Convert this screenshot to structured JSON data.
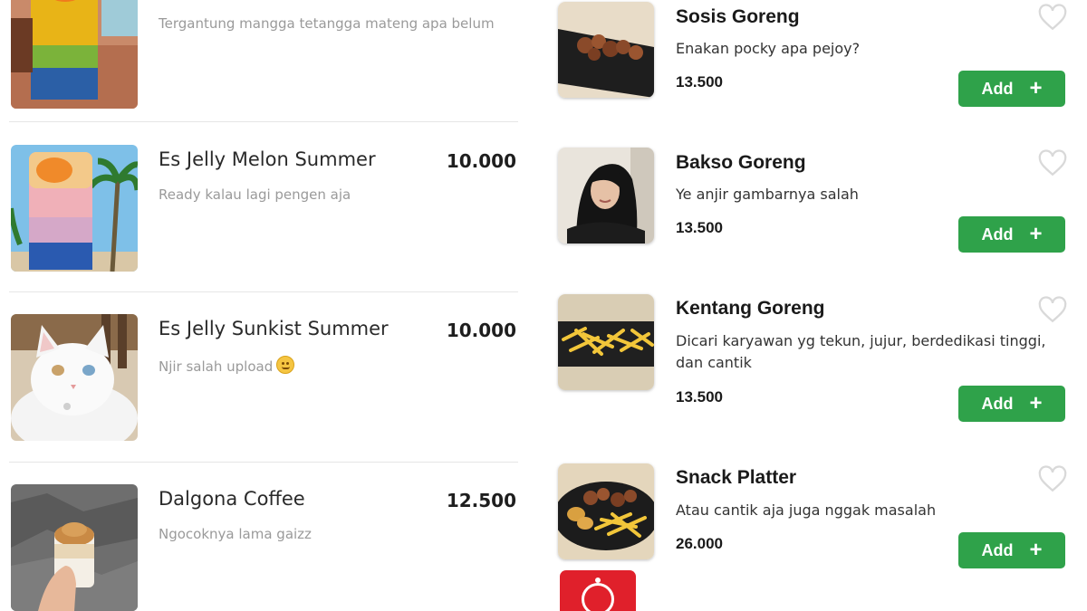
{
  "left_menu": {
    "items": [
      {
        "name": "",
        "price": "",
        "description": "Tergantung mangga tetangga mateng apa belum",
        "image": "layered-fruit-drink"
      },
      {
        "name": "Es Jelly Melon Summer",
        "price": "10.000",
        "description": "Ready kalau lagi pengen aja",
        "image": "melon-jelly-drink"
      },
      {
        "name": "Es Jelly Sunkist Summer",
        "price": "10.000",
        "description": "Njir salah upload",
        "image": "white-cat-photo",
        "emoji": "grimacing-face"
      },
      {
        "name": "Dalgona Coffee",
        "price": "12.500",
        "description": "Ngocoknya lama gaizz",
        "image": "dalgona-coffee-cup"
      }
    ]
  },
  "right_menu": {
    "add_label": "Add",
    "items": [
      {
        "name": "Sosis Goreng",
        "description": "Enakan pocky apa pejoy?",
        "price": "13.500",
        "image": "fried-sausage-plate"
      },
      {
        "name": "Bakso Goreng",
        "description": "Ye anjir gambarnya salah",
        "price": "13.500",
        "image": "woman-selfie-photo"
      },
      {
        "name": "Kentang Goreng",
        "description": "Dicari karyawan yg tekun, jujur, berdedikasi tinggi, dan cantik",
        "price": "13.500",
        "image": "french-fries-plate"
      },
      {
        "name": "Snack Platter",
        "description": "Atau cantik aja juga nggak masalah",
        "price": "26.000",
        "image": "snack-platter-plate"
      }
    ],
    "cart_icon": "cart-icon"
  },
  "colors": {
    "add_button": "#2fa24a",
    "price_text": "#1e1e1e",
    "muted_text": "#9a9a9a",
    "heart": "#d9d9d9",
    "cart_fab": "#e0202b"
  }
}
